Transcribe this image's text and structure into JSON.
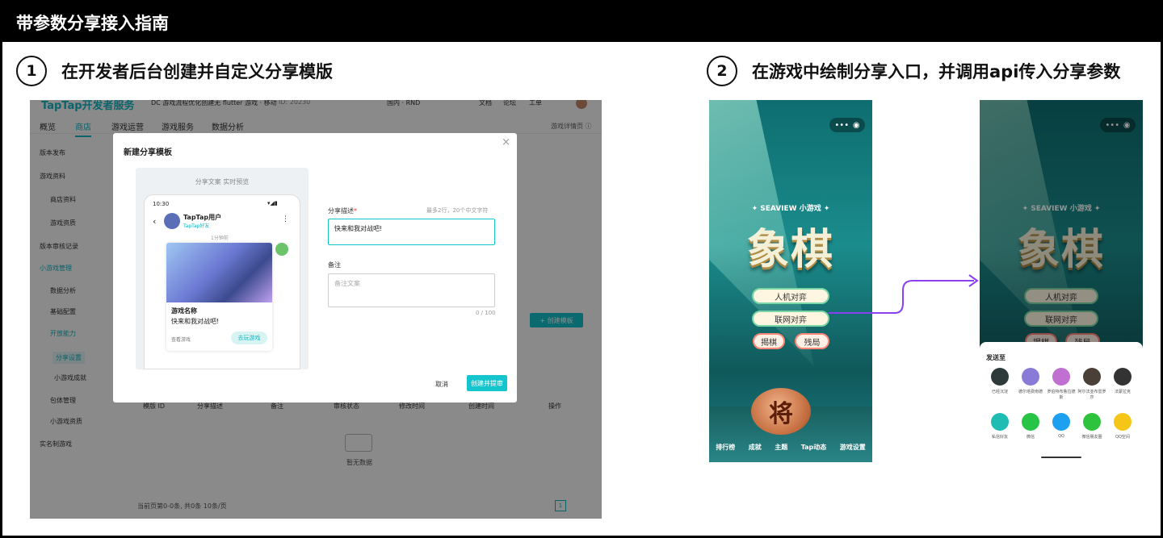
{
  "header": {
    "title": "带参数分享接入指南"
  },
  "steps": [
    {
      "num": "1",
      "title": "在开发者后台创建并自定义分享模版"
    },
    {
      "num": "2",
      "title": "在游戏中绘制分享入口，并调用api传入分享参数"
    }
  ],
  "console": {
    "logo": "TapTap开发者服务",
    "top_game": "DC 游戏流程优化创建无 flutter 游戏 · 移动",
    "top_id": "ID: 20230",
    "top_region": "国内 · RND",
    "top_links": [
      "文档",
      "论坛",
      "工单"
    ],
    "nav": [
      "概览",
      "商店",
      "游戏运营",
      "游戏服务",
      "数据分析"
    ],
    "nav_right": "游戏详情页 ⓘ",
    "sidebar": [
      "版本发布",
      "游戏资料",
      "商店资料",
      "游戏资质",
      "版本审核记录",
      "小游戏管理",
      "数据分析",
      "基础配置",
      "开放能力",
      "分享设置",
      "小游戏成就",
      "包体管理",
      "小游戏资质",
      "实名制游戏"
    ],
    "create_button": "+ 创建模板",
    "table_headers": [
      "模版 ID",
      "分享描述",
      "备注",
      "审核状态",
      "修改时间",
      "创建时间",
      "操作"
    ],
    "empty": "暂无数据",
    "pagination": "当前页第0-0条, 共0条  10条/页",
    "page_number": "1",
    "modal": {
      "title": "新建分享模板",
      "preview_label": "分享文案 实时预览",
      "phone_time": "10:30",
      "user_name": "TapTap用户",
      "user_tag": "TapTap好友",
      "time_ago": "1分钟前",
      "game_name": "游戏名称",
      "share_text": "快来和我对战吧!",
      "view_game": "查看游戏",
      "play_button": "去玩游戏",
      "desc_label": "分享描述",
      "desc_hint": "最多2行，20个中文字符",
      "desc_value": "快来和我对战吧!",
      "note_label": "备注",
      "note_placeholder": "备注文案",
      "note_count": "0 / 100",
      "cancel": "取消",
      "submit": "创建并提审"
    }
  },
  "game": {
    "subtitle": "✦ SEAVIEW 小游戏 ✦",
    "title": "象棋",
    "buttons": [
      "人机对弈",
      "联网对弈",
      "揭棋",
      "残局"
    ],
    "piece": "将",
    "tabs": [
      "排行榜",
      "成就",
      "主题",
      "Tap动态",
      "游戏设置"
    ],
    "capsule": [
      "•••",
      "◉"
    ]
  },
  "share_sheet": {
    "title": "发送至",
    "friends": [
      "已经沉淀",
      "德尔塔费南德",
      "罗伯特布鲁拉德斯",
      "阿尔法亚布雷罗莎",
      "法蒙拉克"
    ],
    "apps": [
      "私信好友",
      "微信",
      "QQ",
      "微信朋友圈",
      "QQ空间"
    ]
  }
}
